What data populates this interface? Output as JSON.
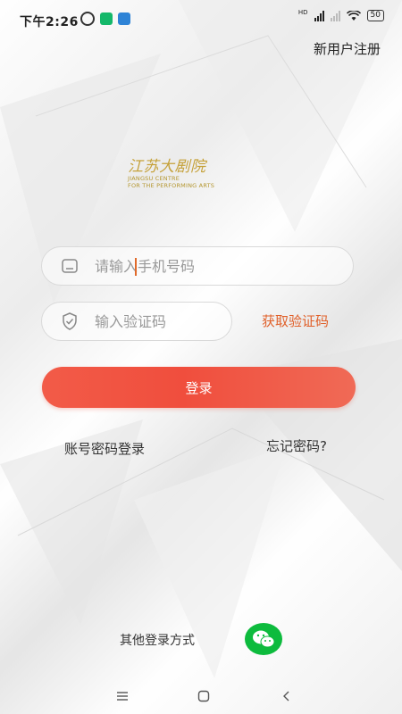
{
  "status_bar": {
    "time": "下午2:26",
    "network_label": "HD",
    "battery": "50"
  },
  "header": {
    "register_label": "新用户注册"
  },
  "logo": {
    "script_text": "江苏大剧院",
    "line1": "JIANGSU CENTRE",
    "line2": "FOR THE PERFORMING ARTS"
  },
  "form": {
    "phone_placeholder": "请输入手机号码",
    "phone_value": "",
    "code_placeholder": "输入验证码",
    "code_value": "",
    "get_code_label": "获取验证码",
    "login_label": "登录",
    "password_login_label": "账号密码登录",
    "forgot_label": "忘记密码?"
  },
  "footer": {
    "other_login_label": "其他登录方式",
    "wechat_icon": "wechat-icon"
  },
  "colors": {
    "accent": "#f04e3d",
    "link_orange": "#e0602a",
    "wechat_green": "#0dbb3d",
    "logo_gold": "#c6a23b"
  }
}
